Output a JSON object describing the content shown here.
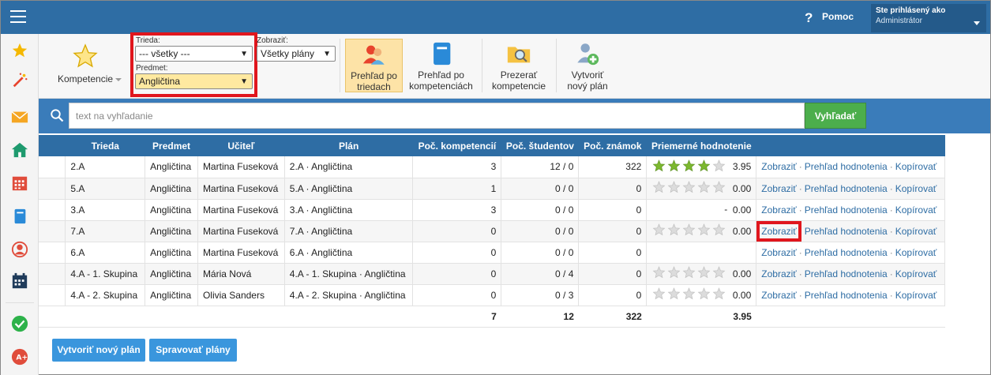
{
  "topbar": {
    "help_label": "Pomoc",
    "user_line1": "Ste prihlásený ako",
    "user_line2": "Administrátor"
  },
  "toolbar": {
    "kompetencie": "Kompetencie",
    "trieda_label": "Trieda:",
    "trieda_value": "--- všetky ---",
    "predmet_label": "Predmet:",
    "predmet_value": "Angličtina",
    "zobrazit_label": "Zobraziť:",
    "zobrazit_value": "Všetky plány",
    "btn_triedy_l1": "Prehľad po",
    "btn_triedy_l2": "triedach",
    "btn_komp_l1": "Prehľad po",
    "btn_komp_l2": "kompetenciách",
    "btn_prezerat_l1": "Prezerať",
    "btn_prezerat_l2": "kompetencie",
    "btn_novy_l1": "Vytvoriť",
    "btn_novy_l2": "nový plán"
  },
  "search": {
    "placeholder": "text na vyhľadanie",
    "button": "Vyhľadať"
  },
  "table": {
    "headers": [
      "Trieda",
      "Predmet",
      "Učiteľ",
      "Plán",
      "Poč. kompetencií",
      "Poč. študentov",
      "Poč. známok",
      "Priemerné hodnotenie"
    ],
    "rows": [
      {
        "trieda": "2.A",
        "predmet": "Angličtina",
        "ucitel": "Martina Fuseková",
        "plan": "2.A · Angličtina",
        "komp": "3",
        "stud": "12 / 0",
        "znamky": "322",
        "stars": 4,
        "rating": "3.95"
      },
      {
        "trieda": "5.A",
        "predmet": "Angličtina",
        "ucitel": "Martina Fuseková",
        "plan": "5.A · Angličtina",
        "komp": "1",
        "stud": "0 / 0",
        "znamky": "0",
        "stars": 0,
        "rating": "0.00"
      },
      {
        "trieda": "3.A",
        "predmet": "Angličtina",
        "ucitel": "Martina Fuseková",
        "plan": "3.A · Angličtina",
        "komp": "3",
        "stud": "0 / 0",
        "znamky": "0",
        "stars": -1,
        "dash": "-",
        "rating": "0.00"
      },
      {
        "trieda": "7.A",
        "predmet": "Angličtina",
        "ucitel": "Martina Fuseková",
        "plan": "7.A · Angličtina",
        "komp": "0",
        "stud": "0 / 0",
        "znamky": "0",
        "stars": 0,
        "rating": "0.00"
      },
      {
        "trieda": "6.A",
        "predmet": "Angličtina",
        "ucitel": "Martina Fuseková",
        "plan": "6.A · Angličtina",
        "komp": "0",
        "stud": "0 / 0",
        "znamky": "0",
        "stars": -1,
        "dash": "",
        "rating": ""
      },
      {
        "trieda": "4.A - 1. Skupina",
        "predmet": "Angličtina",
        "ucitel": "Mária Nová",
        "plan": "4.A - 1. Skupina · Angličtina",
        "komp": "0",
        "stud": "0 / 4",
        "znamky": "0",
        "stars": 0,
        "rating": "0.00"
      },
      {
        "trieda": "4.A - 2. Skupina",
        "predmet": "Angličtina",
        "ucitel": "Olivia Sanders",
        "plan": "4.A - 2. Skupina · Angličtina",
        "komp": "0",
        "stud": "0 / 3",
        "znamky": "0",
        "stars": 0,
        "rating": "0.00"
      }
    ],
    "actions": [
      "Zobraziť",
      "Prehľad hodnotenia",
      "Kopírovať"
    ],
    "totals": {
      "komp": "7",
      "stud": "12",
      "znamky": "322",
      "rating": "3.95"
    }
  },
  "bottom": {
    "create": "Vytvoriť nový plán",
    "manage": "Spravovať plány"
  },
  "colors": {
    "primary": "#2e6da4",
    "highlight": "#e0161d",
    "search_button": "#4cae4c",
    "star": "#7cb82f"
  }
}
